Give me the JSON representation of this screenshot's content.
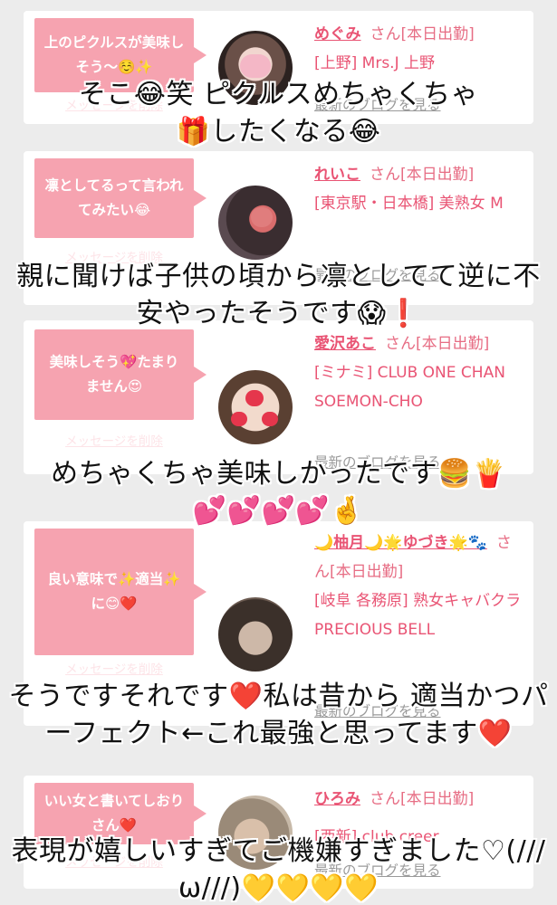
{
  "delete_label": "メッセージを削除",
  "blog_label": "最新のブログを見る",
  "cards": [
    {
      "message": "上のピクルスが美味しそう〜☺️✨",
      "name": "めぐみ",
      "honorific": "さん[本日出勤]",
      "shop": "[上野] Mrs.J 上野"
    },
    {
      "message": "凛としてるって言われてみたい😂",
      "name": "れいこ",
      "honorific": "さん[本日出勤]",
      "shop": "[東京駅・日本橋] 美熟女 M"
    },
    {
      "message": "美味しそう💖たまりません😍",
      "name": "愛沢あこ",
      "honorific": "さん[本日出勤]",
      "shop": "[ミナミ] CLUB ONE CHAN SOEMON-CHO"
    },
    {
      "message": "良い意味で✨適当✨に😊❤️",
      "name": "🌙柚月🌙🌟ゆづき🌟🐾",
      "honorific": "さん[本日出勤]",
      "shop": "[岐阜 各務原] 熟女キャバクラ PRECIOUS BELL"
    },
    {
      "message": "いい女と書いてしおりさん❤️",
      "name": "ひろみ",
      "honorific": "さん[本日出勤]",
      "shop": "[西新] club creer"
    }
  ],
  "captions": [
    "そこ😂笑 ピクルスめちゃくちゃ\n🎁したくなる😂",
    "親に聞けば子供の頃から凛としてて逆に不安やったそうです😱❗",
    "めちゃくちゃ美味しかったです🍔🍟\n💕💕💕💕🤞",
    "そうですそれです❤️私は昔から 適当かつパーフェクト←これ最強と思ってます❤️",
    "表現が嬉しいすぎてご機嫌すぎました♡(///ω///)💛💛💛💛"
  ],
  "colors": {
    "accent": "#e95474",
    "bubble": "#f6a3b0",
    "background": "#ececec"
  }
}
